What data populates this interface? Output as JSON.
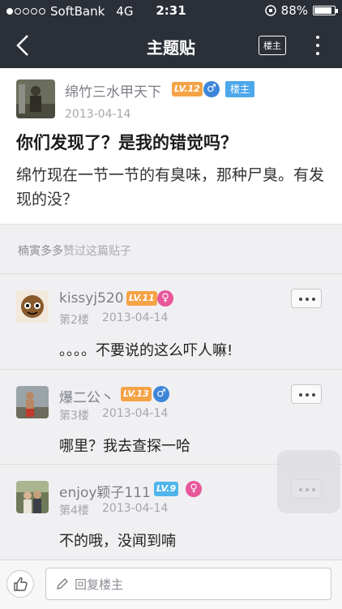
{
  "status": {
    "carrier": "SoftBank",
    "network": "4G",
    "time": "2:31",
    "battery": "88%",
    "battery_level": 0.88
  },
  "nav": {
    "title": "主题贴",
    "owner_button": "楼主",
    "back_icon": "chevron-left-icon",
    "more_icon": "vertical-dots-icon"
  },
  "post": {
    "author": "绵竹三水甲天下",
    "level": "LV.12",
    "gender": "♂",
    "owner_tag": "楼主",
    "date": "2013-04-14",
    "title": "你们发现了？是我的错觉吗？",
    "body": "绵竹现在一节一节的有臭味，那种尸臭。有发现的没？"
  },
  "likes": {
    "user": "楠寅多多",
    "text": "赞过这篇贴子"
  },
  "replies": [
    {
      "author": "kissyj520",
      "level": "LV.11",
      "gender": "♀",
      "floor": "第2楼",
      "date": "2013-04-14",
      "content": "。。。。不要说的这么吓人嘛!"
    },
    {
      "author": "爆二公丶",
      "level": "LV.13",
      "gender": "♂",
      "floor": "第3楼",
      "date": "2013-04-14",
      "content": "哪里？我去查探一哈"
    },
    {
      "author": "enjoy颖子111",
      "level": "LV.9",
      "gender": "♀",
      "floor": "第4楼",
      "date": "2013-04-14",
      "content": "不的哦，没闻到喃"
    }
  ],
  "bottom": {
    "reply_placeholder": "回复楼主",
    "like_icon": "thumbs-up-icon",
    "pen_icon": "pen-icon"
  },
  "colors": {
    "header": "#2b2f38",
    "level_orange": "#f5a347",
    "level_blue": "#4fb5ea",
    "male": "#3e86d8",
    "female": "#e8569b",
    "owner_tag": "#4da7ea"
  }
}
